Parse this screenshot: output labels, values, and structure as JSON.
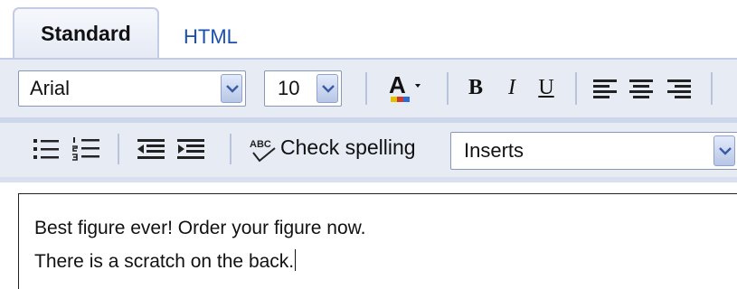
{
  "tabs": [
    {
      "label": "Standard",
      "active": true
    },
    {
      "label": "HTML",
      "active": false
    }
  ],
  "toolbar": {
    "font_family": "Arial",
    "font_size": "10",
    "check_spelling_label": "Check spelling",
    "insert_select": "Inserts",
    "icons": [
      "font-color-icon",
      "bold-icon",
      "italic-icon",
      "underline-icon",
      "align-left-icon",
      "align-center-icon",
      "align-right-icon",
      "bullet-list-icon",
      "numbered-list-icon",
      "outdent-icon",
      "indent-icon",
      "spellcheck-icon"
    ],
    "bold_glyph": "B",
    "italic_glyph": "I",
    "underline_glyph": "U",
    "font_color_glyph": "A",
    "spell_glyph": "ABC"
  },
  "editor": {
    "lines": [
      "Best figure ever! Order your figure now.",
      "There is a scratch on the back."
    ]
  },
  "colors": {
    "tab_link": "#1a4fb0",
    "toolbar_bg": "#e6ebf4",
    "border": "#c3cce4"
  }
}
